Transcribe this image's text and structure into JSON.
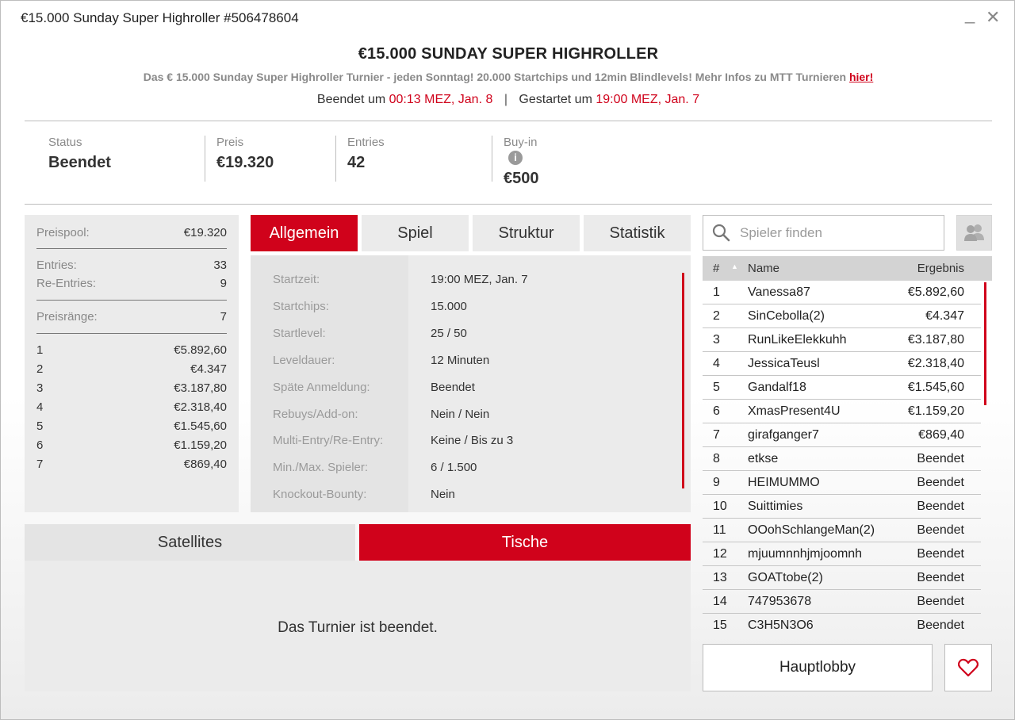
{
  "window": {
    "title": "€15.000 Sunday Super Highroller #506478604",
    "minimize": "_",
    "close": "✕"
  },
  "header": {
    "title": "€15.000 SUNDAY SUPER HIGHROLLER",
    "description": "Das € 15.000 Sunday Super Highroller Turnier - jeden Sonntag! 20.000 Startchips und 12min Blindlevels! Mehr Infos zu MTT Turnieren",
    "link": "hier!",
    "ended_label": "Beendet um",
    "ended_time": "00:13 MEZ, Jan. 8",
    "separator": "|",
    "started_label": "Gestartet um",
    "started_time": "19:00 MEZ, Jan. 7"
  },
  "stats": [
    {
      "label": "Status",
      "value": "Beendet"
    },
    {
      "label": "Preis",
      "value": "€19.320"
    },
    {
      "label": "Entries",
      "value": "42"
    },
    {
      "label": "Buy-in",
      "value": "€500",
      "icon": "info-icon",
      "icon_glyph": "i"
    }
  ],
  "prizepool": {
    "pool_label": "Preispool:",
    "pool_value": "€19.320",
    "entries_label": "Entries:",
    "entries_value": "33",
    "reentries_label": "Re-Entries:",
    "reentries_value": "9",
    "ranks_label": "Preisränge:",
    "ranks_value": "7",
    "payouts": [
      {
        "place": "1",
        "amount": "€5.892,60"
      },
      {
        "place": "2",
        "amount": "€4.347"
      },
      {
        "place": "3",
        "amount": "€3.187,80"
      },
      {
        "place": "4",
        "amount": "€2.318,40"
      },
      {
        "place": "5",
        "amount": "€1.545,60"
      },
      {
        "place": "6",
        "amount": "€1.159,20"
      },
      {
        "place": "7",
        "amount": "€869,40"
      }
    ]
  },
  "tabs": [
    {
      "label": "Allgemein",
      "active": true
    },
    {
      "label": "Spiel",
      "active": false
    },
    {
      "label": "Struktur",
      "active": false
    },
    {
      "label": "Statistik",
      "active": false
    }
  ],
  "details": [
    {
      "key": "Startzeit:",
      "value": "19:00 MEZ, Jan. 7"
    },
    {
      "key": "Startchips:",
      "value": "15.000"
    },
    {
      "key": "Startlevel:",
      "value": "25 / 50"
    },
    {
      "key": "Leveldauer:",
      "value": "12 Minuten"
    },
    {
      "key": "Späte Anmeldung:",
      "value": "Beendet"
    },
    {
      "key": "Rebuys/Add-on:",
      "value": "Nein / Nein"
    },
    {
      "key": "Multi-Entry/Re-Entry:",
      "value": "Keine / Bis zu 3"
    },
    {
      "key": "Min./Max. Spieler:",
      "value": "6 / 1.500"
    },
    {
      "key": "Knockout-Bounty:",
      "value": "Nein"
    }
  ],
  "bottom_tabs": {
    "satellites": "Satellites",
    "tables": "Tische",
    "message": "Das Turnier ist beendet."
  },
  "search": {
    "placeholder": "Spieler finden"
  },
  "players_header": {
    "rank": "#",
    "sort": "▲",
    "name": "Name",
    "result": "Ergebnis"
  },
  "players": [
    {
      "rank": "1",
      "name": "Vanessa87",
      "result": "€5.892,60"
    },
    {
      "rank": "2",
      "name": "SinCebolla(2)",
      "result": "€4.347"
    },
    {
      "rank": "3",
      "name": "RunLikeElekkuhh",
      "result": "€3.187,80"
    },
    {
      "rank": "4",
      "name": "JessicaTeusl",
      "result": "€2.318,40"
    },
    {
      "rank": "5",
      "name": "Gandalf18",
      "result": "€1.545,60"
    },
    {
      "rank": "6",
      "name": "XmasPresent4U",
      "result": "€1.159,20"
    },
    {
      "rank": "7",
      "name": "girafganger7",
      "result": "€869,40"
    },
    {
      "rank": "8",
      "name": "etkse",
      "result": "Beendet"
    },
    {
      "rank": "9",
      "name": "HEIMUMMO",
      "result": "Beendet"
    },
    {
      "rank": "10",
      "name": "Suittimies",
      "result": "Beendet"
    },
    {
      "rank": "11",
      "name": "OOohSchlangeMan(2)",
      "result": "Beendet"
    },
    {
      "rank": "12",
      "name": "mjuumnnhjmjoomnh",
      "result": "Beendet"
    },
    {
      "rank": "13",
      "name": "GOATtobe(2)",
      "result": "Beendet"
    },
    {
      "rank": "14",
      "name": "747953678",
      "result": "Beendet"
    },
    {
      "rank": "15",
      "name": "C3H5N3O6",
      "result": "Beendet"
    }
  ],
  "buttons": {
    "lobby": "Hauptlobby"
  },
  "colors": {
    "accent": "#d0021b",
    "panel": "#ebebeb"
  }
}
